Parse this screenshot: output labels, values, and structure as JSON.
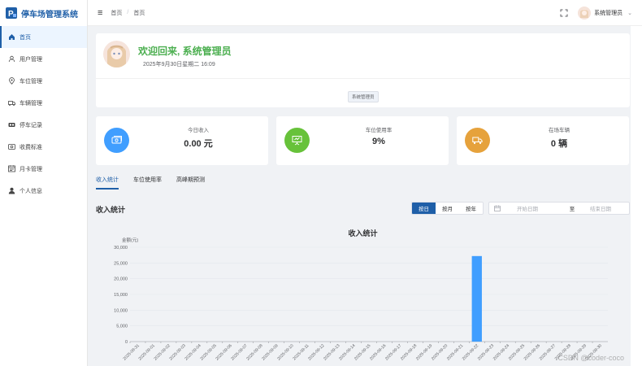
{
  "brand": {
    "title": "停车场管理系统"
  },
  "sidebar": {
    "items": [
      {
        "label": "首页",
        "icon": "home-icon",
        "active": true
      },
      {
        "label": "用户管理",
        "icon": "user-icon",
        "active": false
      },
      {
        "label": "车位管理",
        "icon": "location-icon",
        "active": false
      },
      {
        "label": "车辆管理",
        "icon": "truck-icon",
        "active": false
      },
      {
        "label": "停车记录",
        "icon": "record-icon",
        "active": false
      },
      {
        "label": "收费标准",
        "icon": "fee-icon",
        "active": false
      },
      {
        "label": "月卡管理",
        "icon": "card-icon",
        "active": false
      },
      {
        "label": "个人信息",
        "icon": "person-icon",
        "active": false
      }
    ]
  },
  "header": {
    "breadcrumb": [
      "首页",
      "首页"
    ],
    "breadcrumb_sep": "/",
    "user_name": "系统管理员"
  },
  "welcome": {
    "title": "欢迎回来, 系统管理员",
    "date": "2025年9月30日星期二 16:09",
    "role_tag": "系统管理员"
  },
  "stats": [
    {
      "label": "今日收入",
      "value": "0.00 元",
      "icon": "money-icon",
      "color": "#409eff"
    },
    {
      "label": "车位使用率",
      "value": "9%",
      "icon": "presentation-icon",
      "color": "#67c23a"
    },
    {
      "label": "在场车辆",
      "value": "0 辆",
      "icon": "vehicle-icon",
      "color": "#e6a23c"
    }
  ],
  "tabs": [
    {
      "label": "收入统计",
      "active": true
    },
    {
      "label": "车位使用率",
      "active": false
    },
    {
      "label": "高峰期预测",
      "active": false
    }
  ],
  "section": {
    "title": "收入统计",
    "buttons": [
      {
        "label": "按日",
        "active": true
      },
      {
        "label": "按月",
        "active": false
      },
      {
        "label": "按年",
        "active": false
      }
    ],
    "date_start_placeholder": "开始日期",
    "date_sep": "至",
    "date_end_placeholder": "结束日期"
  },
  "chart_data": {
    "type": "bar",
    "title": "收入统计",
    "ylabel": "金额(元)",
    "xlabel": "",
    "ylim": [
      0,
      30000
    ],
    "yticks": [
      0,
      5000,
      10000,
      15000,
      20000,
      25000,
      30000
    ],
    "ytick_labels": [
      "0",
      "5,000",
      "10,000",
      "15,000",
      "20,000",
      "25,000",
      "30,000"
    ],
    "grid": true,
    "bar_color": "#409eff",
    "categories": [
      "2025-08-31",
      "2025-09-01",
      "2025-09-02",
      "2025-09-03",
      "2025-09-04",
      "2025-09-05",
      "2025-09-06",
      "2025-09-07",
      "2025-09-08",
      "2025-09-09",
      "2025-09-10",
      "2025-09-11",
      "2025-09-12",
      "2025-09-13",
      "2025-09-14",
      "2025-09-15",
      "2025-09-16",
      "2025-09-17",
      "2025-09-18",
      "2025-09-19",
      "2025-09-20",
      "2025-09-21",
      "2025-09-22",
      "2025-09-23",
      "2025-09-24",
      "2025-09-25",
      "2025-09-26",
      "2025-09-27",
      "2025-09-28",
      "2025-09-29",
      "2025-09-30"
    ],
    "values": [
      0,
      0,
      0,
      0,
      0,
      0,
      0,
      0,
      0,
      0,
      0,
      0,
      0,
      0,
      0,
      0,
      0,
      0,
      0,
      0,
      0,
      0,
      27200,
      0,
      0,
      0,
      0,
      0,
      0,
      0,
      0
    ]
  },
  "watermark": "CSDN @coder-coco"
}
